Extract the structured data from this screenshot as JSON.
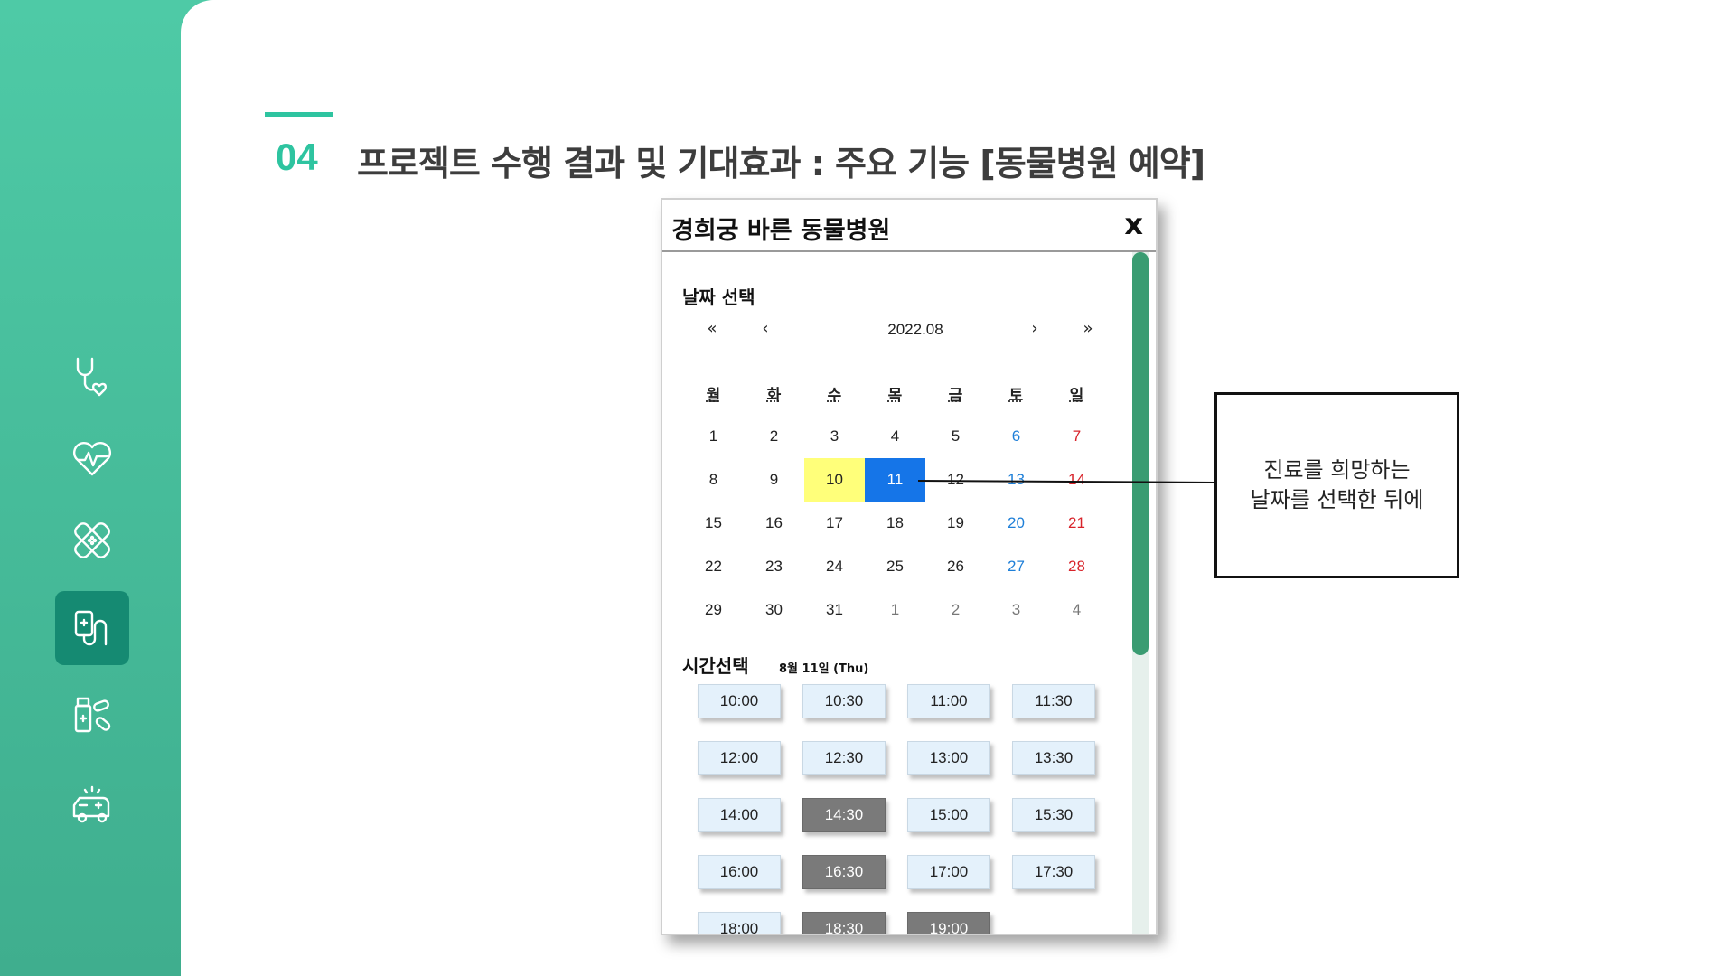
{
  "slide": {
    "section_number": "04",
    "title": "프로젝트 수행 결과 및 기대효과 : 주요 기능 [동물병원 예약]"
  },
  "sidebar": {
    "icons": [
      {
        "name": "stethoscope-heart-icon",
        "active": false
      },
      {
        "name": "heartbeat-icon",
        "active": false
      },
      {
        "name": "bandage-icon",
        "active": false
      },
      {
        "name": "iv-drip-icon",
        "active": true
      },
      {
        "name": "medicine-bottle-icon",
        "active": false
      },
      {
        "name": "ambulance-icon",
        "active": false
      }
    ]
  },
  "popup": {
    "title": "경희궁 바른 동물병원",
    "close_label": "x",
    "date_section_label": "날짜 선택",
    "nav": {
      "prev_year": "«",
      "prev_month": "‹",
      "next_month": "›",
      "next_year": "»"
    },
    "month": "2022.08",
    "weekdays": [
      "월",
      "화",
      "수",
      "목",
      "금",
      "토",
      "일"
    ],
    "weeks": [
      [
        {
          "d": "1"
        },
        {
          "d": "2"
        },
        {
          "d": "3"
        },
        {
          "d": "4"
        },
        {
          "d": "5"
        },
        {
          "d": "6",
          "t": "sat"
        },
        {
          "d": "7",
          "t": "sun"
        }
      ],
      [
        {
          "d": "8"
        },
        {
          "d": "9"
        },
        {
          "d": "10",
          "t": "today"
        },
        {
          "d": "11",
          "t": "selected"
        },
        {
          "d": "12"
        },
        {
          "d": "13",
          "t": "sat"
        },
        {
          "d": "14",
          "t": "sun"
        }
      ],
      [
        {
          "d": "15"
        },
        {
          "d": "16"
        },
        {
          "d": "17"
        },
        {
          "d": "18"
        },
        {
          "d": "19"
        },
        {
          "d": "20",
          "t": "sat"
        },
        {
          "d": "21",
          "t": "sun"
        }
      ],
      [
        {
          "d": "22"
        },
        {
          "d": "23"
        },
        {
          "d": "24"
        },
        {
          "d": "25"
        },
        {
          "d": "26"
        },
        {
          "d": "27",
          "t": "sat"
        },
        {
          "d": "28",
          "t": "sun"
        }
      ],
      [
        {
          "d": "29"
        },
        {
          "d": "30"
        },
        {
          "d": "31"
        },
        {
          "d": "1",
          "t": "other"
        },
        {
          "d": "2",
          "t": "other"
        },
        {
          "d": "3",
          "t": "other"
        },
        {
          "d": "4",
          "t": "other"
        }
      ]
    ],
    "time_section_label": "시간선택",
    "selected_date_label": "8월 11일 (Thu)",
    "time_slots": [
      {
        "time": "10:00",
        "booked": false
      },
      {
        "time": "10:30",
        "booked": false
      },
      {
        "time": "11:00",
        "booked": false
      },
      {
        "time": "11:30",
        "booked": false
      },
      {
        "time": "12:00",
        "booked": false
      },
      {
        "time": "12:30",
        "booked": false
      },
      {
        "time": "13:00",
        "booked": false
      },
      {
        "time": "13:30",
        "booked": false
      },
      {
        "time": "14:00",
        "booked": false
      },
      {
        "time": "14:30",
        "booked": true
      },
      {
        "time": "15:00",
        "booked": false
      },
      {
        "time": "15:30",
        "booked": false
      },
      {
        "time": "16:00",
        "booked": false
      },
      {
        "time": "16:30",
        "booked": true
      },
      {
        "time": "17:00",
        "booked": false
      },
      {
        "time": "17:30",
        "booked": false
      },
      {
        "time": "18:00",
        "booked": false
      },
      {
        "time": "18:30",
        "booked": true
      },
      {
        "time": "19:00",
        "booked": true
      }
    ]
  },
  "callout": {
    "line1": "진료를 희망하는",
    "line2": "날짜를 선택한 뒤에"
  },
  "colors": {
    "accent": "#2ec4a0",
    "sidebar_bg": "#4ecaa6",
    "active_icon_bg": "#158a72",
    "today_highlight": "#ffff7a",
    "selected_date": "#1575e8",
    "booked_slot": "#7a7a7a",
    "available_slot": "#e4f1fb",
    "saturday": "#1e7fd8",
    "sunday": "#d8232a"
  }
}
